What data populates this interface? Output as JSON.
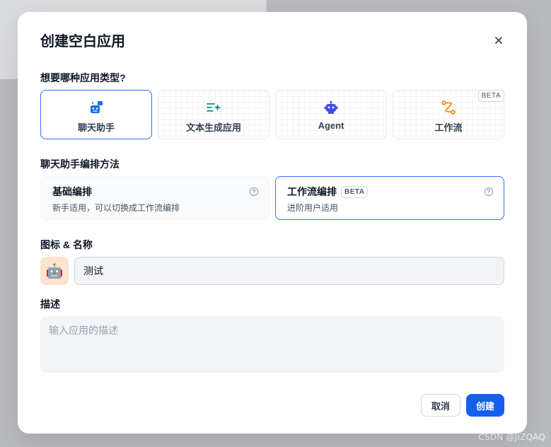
{
  "watermark": "CSDN @JIZQAQ",
  "modal": {
    "title": "创建空白应用",
    "close_icon": "close-icon"
  },
  "app_type": {
    "label": "想要哪种应用类型?",
    "options": [
      {
        "label": "聊天助手",
        "icon": "chat-bot-icon",
        "color": "#1570ef",
        "selected": true
      },
      {
        "label": "文本生成应用",
        "icon": "text-generation-icon",
        "color": "#0e9384",
        "selected": false
      },
      {
        "label": "Agent",
        "icon": "agent-robot-icon",
        "color": "#444ce7",
        "selected": false
      },
      {
        "label": "工作流",
        "icon": "workflow-icon",
        "color": "#f79009",
        "selected": false,
        "badge": "BETA"
      }
    ]
  },
  "orchestration": {
    "label": "聊天助手编排方法",
    "options": [
      {
        "title": "基础编排",
        "desc": "新手适用，可以切换成工作流编排",
        "selected": false
      },
      {
        "title": "工作流编排",
        "badge": "BETA",
        "desc": "进阶用户适用",
        "selected": true
      }
    ]
  },
  "icon_name": {
    "label": "图标 & 名称",
    "avatar_emoji": "🤖",
    "avatar_bg": "#fde4cf",
    "name_value": "测试"
  },
  "description": {
    "label": "描述",
    "placeholder": "输入应用的描述",
    "value": ""
  },
  "buttons": {
    "cancel": "取消",
    "create": "创建"
  },
  "colors": {
    "accent": "#155eef",
    "selected_border": "#2970ff"
  }
}
